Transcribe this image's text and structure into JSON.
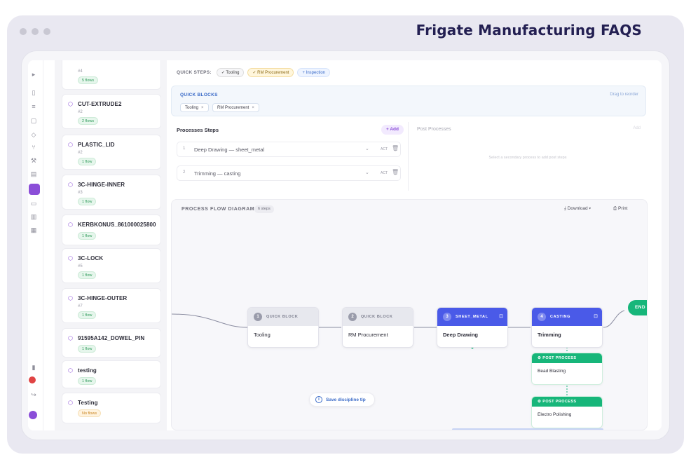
{
  "frame": {
    "title": "Frigate Manufacturing FAQS"
  },
  "rail": {
    "icons": [
      "panel-toggle-icon",
      "doc-icon",
      "layers-icon",
      "box-icon",
      "cube-icon",
      "branch-icon",
      "tool-icon",
      "page-icon",
      "active-app-icon",
      "file-icon",
      "archive-icon",
      "grid-icon",
      "chart-icon",
      "settings-icon",
      "notification-icon",
      "logout-icon",
      "user-avatar"
    ]
  },
  "parts": [
    {
      "name": "",
      "number": "#4",
      "status": "5 flows",
      "warn": false
    },
    {
      "name": "CUT-EXTRUDE2",
      "number": "#2",
      "status": "2 flows",
      "warn": false
    },
    {
      "name": "PLASTIC_LID",
      "number": "#2",
      "status": "1 flow",
      "warn": false
    },
    {
      "name": "3C-HINGE-INNER",
      "number": "#3",
      "status": "1 flow",
      "warn": false
    },
    {
      "name": "KERBKONUS_861000025800",
      "number": "",
      "status": "1 flow",
      "warn": false
    },
    {
      "name": "3C-LOCK",
      "number": "#5",
      "status": "1 flow",
      "warn": false
    },
    {
      "name": "3C-HINGE-OUTER",
      "number": "#7",
      "status": "1 flow",
      "warn": false
    },
    {
      "name": "91595A142_DOWEL_PIN",
      "number": "",
      "status": "1 flow",
      "warn": false
    },
    {
      "name": "testing",
      "number": "",
      "status": "1 flow",
      "warn": false
    },
    {
      "name": "Testing",
      "number": "",
      "status": "No flows",
      "warn": true
    }
  ],
  "quick_steps": {
    "label": "QUICK STEPS:",
    "chips": [
      {
        "label": "✓ Tooling",
        "style": "grey"
      },
      {
        "label": "✓ RM Procurement",
        "style": "yellow"
      },
      {
        "label": "+ Inspection",
        "style": "blue"
      }
    ]
  },
  "quick_blocks": {
    "title": "QUICK BLOCKS",
    "hint": "Drag to reorder",
    "tags": [
      "Tooling",
      "RM Procurement"
    ]
  },
  "process_steps": {
    "title": "Processes Steps",
    "add_label": "+ Add",
    "steps": [
      {
        "n": "1",
        "text": "Deep Drawing — sheet_metal",
        "act": "ACT"
      },
      {
        "n": "2",
        "text": "Trimming — casting",
        "act": "ACT"
      }
    ]
  },
  "post_processes": {
    "title": "Post Processes",
    "button": "Add",
    "empty": "Select a secondary process to add post steps"
  },
  "flow": {
    "title": "PROCESS FLOW DIAGRAM",
    "count": "6 steps",
    "download": "Download",
    "print": "Print",
    "nodes": [
      {
        "num": "1",
        "type": "QUICK BLOCK",
        "label": "Tooling",
        "style": "grey"
      },
      {
        "num": "2",
        "type": "QUICK BLOCK",
        "label": "RM Procurement",
        "style": "grey"
      },
      {
        "num": "3",
        "type": "SHEET_METAL",
        "label": "Deep Drawing",
        "style": "blue"
      },
      {
        "num": "4",
        "type": "CASTING",
        "label": "Trimming",
        "style": "blue"
      }
    ],
    "post_nodes": [
      {
        "type": "POST PROCESS",
        "label": "Bead Blasting"
      },
      {
        "type": "POST PROCESS",
        "label": "Electro Polishing"
      }
    ],
    "end_label": "END",
    "tip": "Save discipline tip"
  },
  "colors": {
    "accent": "#8b4ed8",
    "node_blue": "#4a5ae8",
    "post_green": "#17b67a",
    "frame_title": "#231f52"
  }
}
